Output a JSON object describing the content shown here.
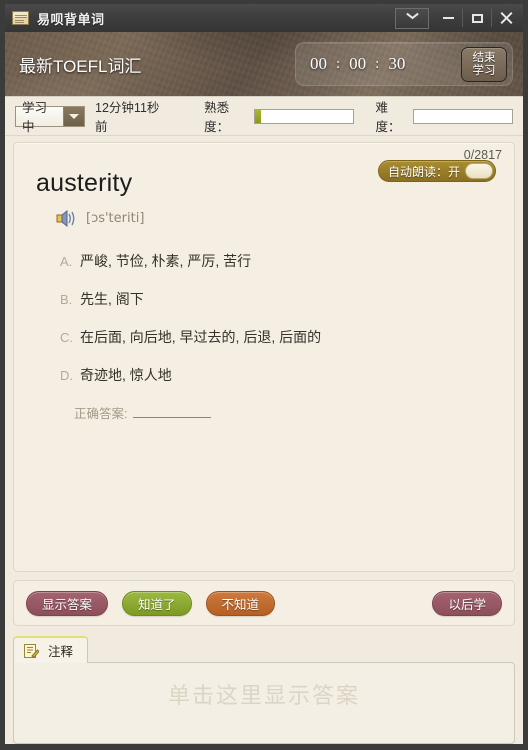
{
  "window": {
    "app_icon": "book-icon",
    "title": "易呗背单词",
    "controls": {
      "expand": "chevron-down-icon",
      "minimize": "minimize-icon",
      "maximize": "maximize-icon",
      "close": "close-icon"
    }
  },
  "header": {
    "book_title": "最新TOEFL词汇",
    "timer": {
      "hours": "00",
      "sep1": ":",
      "minutes": "00",
      "sep2": ":",
      "seconds": "30"
    },
    "end_study_line1": "结束",
    "end_study_line2": "学习"
  },
  "toolbar": {
    "status_value": "学习中",
    "status_arrow": "chevron-down-icon",
    "last_time": "12分钟11秒前",
    "familiarity_label": "熟悉度：",
    "familiarity_percent": 6,
    "difficulty_label": "难度：",
    "difficulty_percent": 0
  },
  "card": {
    "counter": "0/2817",
    "word": "austerity",
    "speaker_icon": "speaker-icon",
    "phonetic": "[ɔs'teriti]",
    "auto_read_label": "自动朗读：开",
    "options": [
      {
        "letter": "A.",
        "text": "严峻, 节俭, 朴素, 严厉, 苦行"
      },
      {
        "letter": "B.",
        "text": "先生, 阁下"
      },
      {
        "letter": "C.",
        "text": "在后面, 向后地, 早过去的, 后退, 后面的"
      },
      {
        "letter": "D.",
        "text": "奇迹地, 惊人地"
      }
    ],
    "answer_label": "正确答案:",
    "answer_value": ""
  },
  "actions": {
    "show_answer": "显示答案",
    "known": "知道了",
    "unknown": "不知道",
    "later": "以后学"
  },
  "notes": {
    "tab_icon": "note-pencil-icon",
    "tab_label": "注释",
    "placeholder": "单击这里显示答案"
  },
  "colors": {
    "header_brown": "#6a5a4c",
    "card_cream": "#f4efe2",
    "accent_green": "#8a9a18",
    "maroon": "#8e4f5c",
    "orange": "#b45f24",
    "gold": "#a98d30"
  }
}
